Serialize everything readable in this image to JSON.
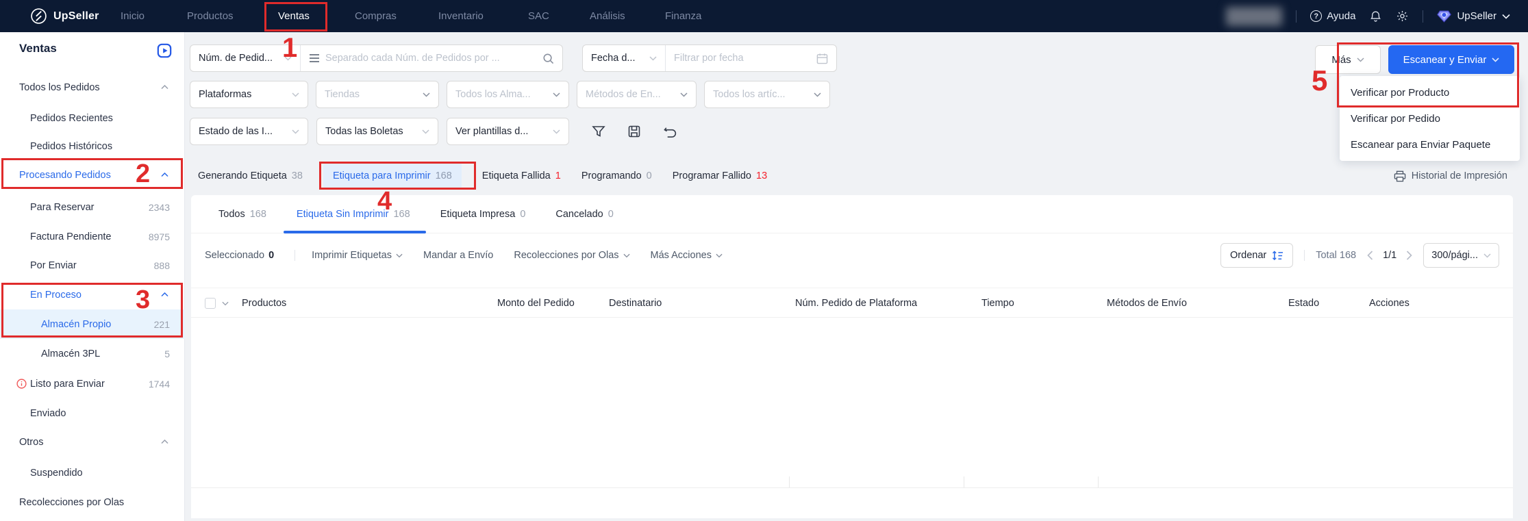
{
  "nav": {
    "brand": "UpSeller",
    "items": [
      {
        "label": "Inicio"
      },
      {
        "label": "Productos"
      },
      {
        "label": "Ventas"
      },
      {
        "label": "Compras"
      },
      {
        "label": "Inventario"
      },
      {
        "label": "SAC"
      },
      {
        "label": "Análisis"
      },
      {
        "label": "Finanza"
      }
    ],
    "help": "Ayuda",
    "account": "UpSeller"
  },
  "icons": {
    "help_glyph": "?"
  },
  "sidebar": {
    "title": "Ventas",
    "items": [
      {
        "label": "Todos los Pedidos"
      },
      {
        "label": "Pedidos Recientes"
      },
      {
        "label": "Pedidos Históricos"
      },
      {
        "label": "Procesando Pedidos"
      },
      {
        "label": "Para Reservar",
        "count": "2343"
      },
      {
        "label": "Factura Pendiente",
        "count": "8975"
      },
      {
        "label": "Por Enviar",
        "count": "888"
      },
      {
        "label": "En Proceso"
      },
      {
        "label": "Almacén Propio",
        "count": "221"
      },
      {
        "label": "Almacén 3PL",
        "count": "5"
      },
      {
        "label": "Listo para Enviar",
        "count": "1744"
      },
      {
        "label": "Enviado"
      },
      {
        "label": "Otros"
      },
      {
        "label": "Suspendido"
      },
      {
        "label": "Recolecciones por Olas"
      }
    ]
  },
  "filters": {
    "order_field": "Núm. de Pedid...",
    "order_placeholder": "Separado cada Núm. de Pedidos por ...",
    "date_field": "Fecha d...",
    "date_placeholder": "Filtrar por fecha",
    "platforms": "Plataformas",
    "stores": "Tiendas",
    "warehouses": "Todos los Alma...",
    "shipping_methods": "Métodos de En...",
    "articles": "Todos los artíc...",
    "invoice_status": "Estado de las I...",
    "boletas": "Todas las Boletas",
    "templates": "Ver plantillas d..."
  },
  "header_actions": {
    "more": "Más",
    "scan_send": "Escanear y Enviar",
    "menu": [
      "Verificar por Producto",
      "Verificar por Pedido",
      "Escanear para Enviar Paquete"
    ]
  },
  "tabs": [
    {
      "label": "Generando Etiqueta",
      "count": "38"
    },
    {
      "label": "Etiqueta para Imprimir",
      "count": "168"
    },
    {
      "label": "Etiqueta Fallida",
      "count": "1"
    },
    {
      "label": "Programando",
      "count": "0"
    },
    {
      "label": "Programar Fallido",
      "count": "13"
    }
  ],
  "print_history": "Historial de Impresión",
  "subtabs": [
    {
      "label": "Todos",
      "count": "168"
    },
    {
      "label": "Etiqueta Sin Imprimir",
      "count": "168"
    },
    {
      "label": "Etiqueta Impresa",
      "count": "0"
    },
    {
      "label": "Cancelado",
      "count": "0"
    }
  ],
  "toolbar": {
    "selected_label": "Seleccionado",
    "selected_count": "0",
    "print_labels": "Imprimir Etiquetas",
    "send": "Mandar a Envío",
    "wave_pick": "Recolecciones por Olas",
    "more_actions": "Más Acciones",
    "sort": "Ordenar",
    "total": "Total 168",
    "page": "1/1",
    "per_page": "300/pági..."
  },
  "table": {
    "columns": [
      "Productos",
      "Monto del Pedido",
      "Destinatario",
      "Núm. Pedido de Plataforma",
      "Tiempo",
      "Métodos de Envío",
      "Estado",
      "Acciones"
    ]
  },
  "annotations": {
    "n1": "1",
    "n2": "2",
    "n3": "3",
    "n4": "4",
    "n5": "5"
  }
}
